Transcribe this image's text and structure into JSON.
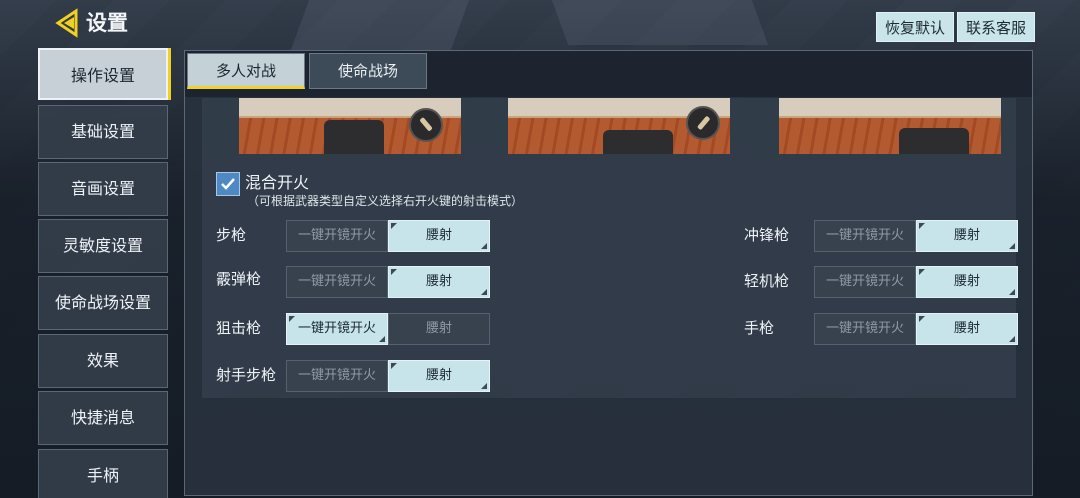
{
  "header": {
    "title": "设置",
    "restore_default": "恢复默认",
    "contact_support": "联系客服"
  },
  "sidebar": {
    "items": [
      {
        "label": "操作设置",
        "active": true
      },
      {
        "label": "基础设置"
      },
      {
        "label": "音画设置"
      },
      {
        "label": "灵敏度设置"
      },
      {
        "label": "使命战场设置"
      },
      {
        "label": "效果"
      },
      {
        "label": "快捷消息"
      },
      {
        "label": "手柄"
      }
    ]
  },
  "tabs": [
    {
      "label": "多人对战",
      "active": true
    },
    {
      "label": "使命战场",
      "active": false
    }
  ],
  "mixed_fire": {
    "checked": true,
    "label": "混合开火",
    "description": "（可根据武器类型自定义选择右开火键的射击模式）"
  },
  "options": {
    "ads": "一键开镜开火",
    "hip": "腰射"
  },
  "weapons_left": [
    {
      "name": "步枪",
      "selected": "腰射"
    },
    {
      "name": "霰弹枪",
      "selected": "腰射"
    },
    {
      "name": "狙击枪",
      "selected": "一键开镜开火"
    },
    {
      "name": "射手步枪",
      "selected": "腰射"
    }
  ],
  "weapons_right": [
    {
      "name": "冲锋枪",
      "selected": "腰射"
    },
    {
      "name": "轻机枪",
      "selected": "腰射"
    },
    {
      "name": "手枪",
      "selected": "腰射"
    }
  ],
  "colors": {
    "accent_yellow": "#f0d020",
    "selected_option": "#c7e4ea",
    "checkbox": "#4e89c6"
  }
}
